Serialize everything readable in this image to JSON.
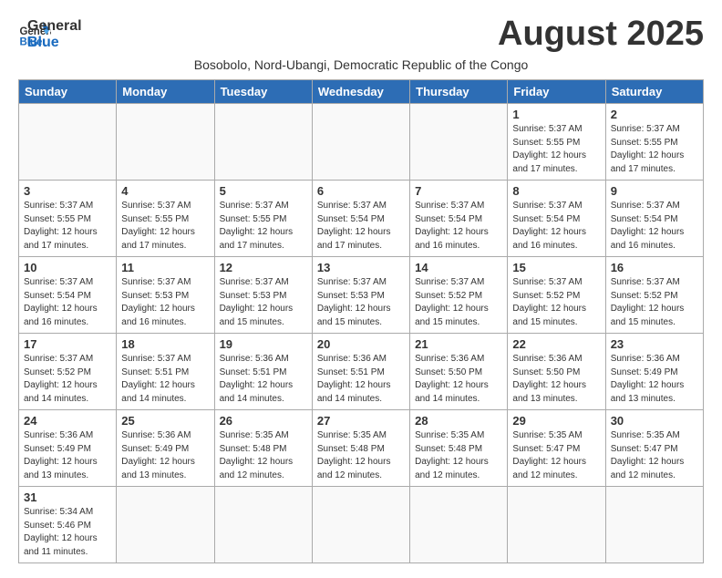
{
  "logo": {
    "text_general": "General",
    "text_blue": "Blue"
  },
  "header": {
    "month_year": "August 2025",
    "subtitle": "Bosobolo, Nord-Ubangi, Democratic Republic of the Congo"
  },
  "weekdays": [
    "Sunday",
    "Monday",
    "Tuesday",
    "Wednesday",
    "Thursday",
    "Friday",
    "Saturday"
  ],
  "weeks": [
    [
      {
        "day": "",
        "info": ""
      },
      {
        "day": "",
        "info": ""
      },
      {
        "day": "",
        "info": ""
      },
      {
        "day": "",
        "info": ""
      },
      {
        "day": "",
        "info": ""
      },
      {
        "day": "1",
        "info": "Sunrise: 5:37 AM\nSunset: 5:55 PM\nDaylight: 12 hours and 17 minutes."
      },
      {
        "day": "2",
        "info": "Sunrise: 5:37 AM\nSunset: 5:55 PM\nDaylight: 12 hours and 17 minutes."
      }
    ],
    [
      {
        "day": "3",
        "info": "Sunrise: 5:37 AM\nSunset: 5:55 PM\nDaylight: 12 hours and 17 minutes."
      },
      {
        "day": "4",
        "info": "Sunrise: 5:37 AM\nSunset: 5:55 PM\nDaylight: 12 hours and 17 minutes."
      },
      {
        "day": "5",
        "info": "Sunrise: 5:37 AM\nSunset: 5:55 PM\nDaylight: 12 hours and 17 minutes."
      },
      {
        "day": "6",
        "info": "Sunrise: 5:37 AM\nSunset: 5:54 PM\nDaylight: 12 hours and 17 minutes."
      },
      {
        "day": "7",
        "info": "Sunrise: 5:37 AM\nSunset: 5:54 PM\nDaylight: 12 hours and 16 minutes."
      },
      {
        "day": "8",
        "info": "Sunrise: 5:37 AM\nSunset: 5:54 PM\nDaylight: 12 hours and 16 minutes."
      },
      {
        "day": "9",
        "info": "Sunrise: 5:37 AM\nSunset: 5:54 PM\nDaylight: 12 hours and 16 minutes."
      }
    ],
    [
      {
        "day": "10",
        "info": "Sunrise: 5:37 AM\nSunset: 5:54 PM\nDaylight: 12 hours and 16 minutes."
      },
      {
        "day": "11",
        "info": "Sunrise: 5:37 AM\nSunset: 5:53 PM\nDaylight: 12 hours and 16 minutes."
      },
      {
        "day": "12",
        "info": "Sunrise: 5:37 AM\nSunset: 5:53 PM\nDaylight: 12 hours and 15 minutes."
      },
      {
        "day": "13",
        "info": "Sunrise: 5:37 AM\nSunset: 5:53 PM\nDaylight: 12 hours and 15 minutes."
      },
      {
        "day": "14",
        "info": "Sunrise: 5:37 AM\nSunset: 5:52 PM\nDaylight: 12 hours and 15 minutes."
      },
      {
        "day": "15",
        "info": "Sunrise: 5:37 AM\nSunset: 5:52 PM\nDaylight: 12 hours and 15 minutes."
      },
      {
        "day": "16",
        "info": "Sunrise: 5:37 AM\nSunset: 5:52 PM\nDaylight: 12 hours and 15 minutes."
      }
    ],
    [
      {
        "day": "17",
        "info": "Sunrise: 5:37 AM\nSunset: 5:52 PM\nDaylight: 12 hours and 14 minutes."
      },
      {
        "day": "18",
        "info": "Sunrise: 5:37 AM\nSunset: 5:51 PM\nDaylight: 12 hours and 14 minutes."
      },
      {
        "day": "19",
        "info": "Sunrise: 5:36 AM\nSunset: 5:51 PM\nDaylight: 12 hours and 14 minutes."
      },
      {
        "day": "20",
        "info": "Sunrise: 5:36 AM\nSunset: 5:51 PM\nDaylight: 12 hours and 14 minutes."
      },
      {
        "day": "21",
        "info": "Sunrise: 5:36 AM\nSunset: 5:50 PM\nDaylight: 12 hours and 14 minutes."
      },
      {
        "day": "22",
        "info": "Sunrise: 5:36 AM\nSunset: 5:50 PM\nDaylight: 12 hours and 13 minutes."
      },
      {
        "day": "23",
        "info": "Sunrise: 5:36 AM\nSunset: 5:49 PM\nDaylight: 12 hours and 13 minutes."
      }
    ],
    [
      {
        "day": "24",
        "info": "Sunrise: 5:36 AM\nSunset: 5:49 PM\nDaylight: 12 hours and 13 minutes."
      },
      {
        "day": "25",
        "info": "Sunrise: 5:36 AM\nSunset: 5:49 PM\nDaylight: 12 hours and 13 minutes."
      },
      {
        "day": "26",
        "info": "Sunrise: 5:35 AM\nSunset: 5:48 PM\nDaylight: 12 hours and 12 minutes."
      },
      {
        "day": "27",
        "info": "Sunrise: 5:35 AM\nSunset: 5:48 PM\nDaylight: 12 hours and 12 minutes."
      },
      {
        "day": "28",
        "info": "Sunrise: 5:35 AM\nSunset: 5:48 PM\nDaylight: 12 hours and 12 minutes."
      },
      {
        "day": "29",
        "info": "Sunrise: 5:35 AM\nSunset: 5:47 PM\nDaylight: 12 hours and 12 minutes."
      },
      {
        "day": "30",
        "info": "Sunrise: 5:35 AM\nSunset: 5:47 PM\nDaylight: 12 hours and 12 minutes."
      }
    ],
    [
      {
        "day": "31",
        "info": "Sunrise: 5:34 AM\nSunset: 5:46 PM\nDaylight: 12 hours and 11 minutes."
      },
      {
        "day": "",
        "info": ""
      },
      {
        "day": "",
        "info": ""
      },
      {
        "day": "",
        "info": ""
      },
      {
        "day": "",
        "info": ""
      },
      {
        "day": "",
        "info": ""
      },
      {
        "day": "",
        "info": ""
      }
    ]
  ]
}
